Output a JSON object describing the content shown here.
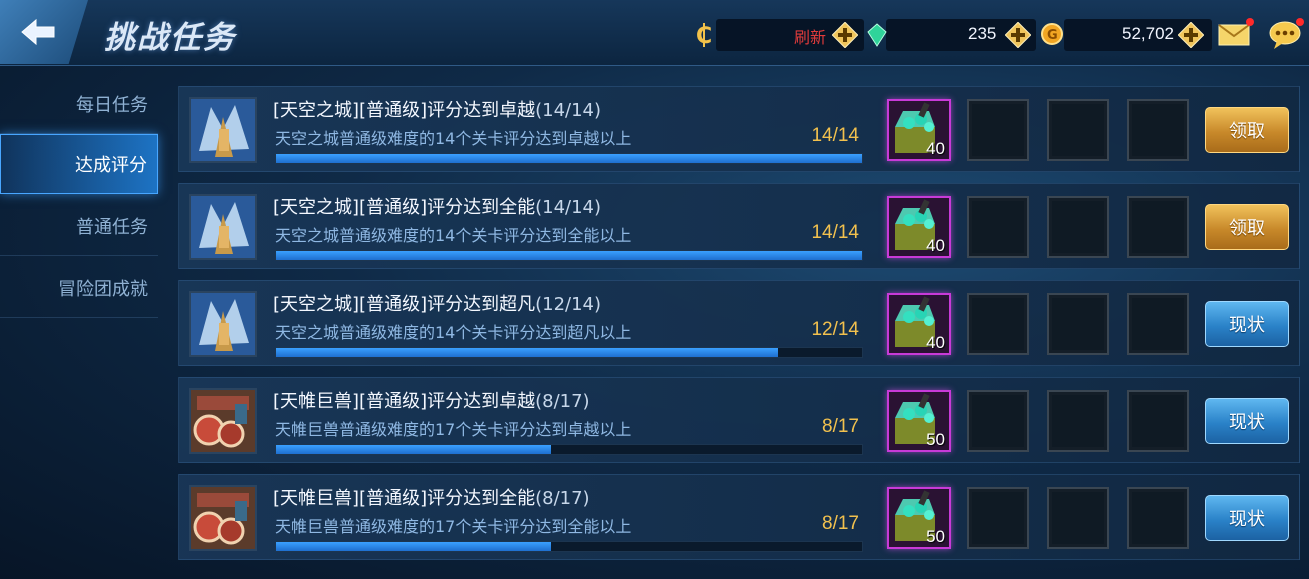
{
  "header": {
    "title": "挑战任务",
    "refresh_label": "刷新",
    "gems_value": "235",
    "gold_value": "52,702"
  },
  "sidebar": {
    "items": [
      {
        "label": "每日任务",
        "active": false
      },
      {
        "label": "达成评分",
        "active": true
      },
      {
        "label": "普通任务",
        "active": false
      },
      {
        "label": "冒险团成就",
        "active": false
      }
    ]
  },
  "tasks": [
    {
      "title": "[天空之城][普通级]评分达到卓越",
      "count": "(14/14)",
      "description": "天空之城普通级难度的14个关卡评分达到卓越以上",
      "progress_text": "14/14",
      "progress": 1.0,
      "reward_qty": "40",
      "button_label": "领取",
      "button_type": "claim",
      "icon": "sky-castle-icon"
    },
    {
      "title": "[天空之城][普通级]评分达到全能",
      "count": "(14/14)",
      "description": "天空之城普通级难度的14个关卡评分达到全能以上",
      "progress_text": "14/14",
      "progress": 1.0,
      "reward_qty": "40",
      "button_label": "领取",
      "button_type": "claim",
      "icon": "sky-castle-icon"
    },
    {
      "title": "[天空之城][普通级]评分达到超凡",
      "count": "(12/14)",
      "description": "天空之城普通级难度的14个关卡评分达到超凡以上",
      "progress_text": "12/14",
      "progress": 0.857,
      "reward_qty": "40",
      "button_label": "现状",
      "button_type": "status",
      "icon": "sky-castle-icon"
    },
    {
      "title": "[天帷巨兽][普通级]评分达到卓越",
      "count": "(8/17)",
      "description": "天帷巨兽普通级难度的17个关卡评分达到卓越以上",
      "progress_text": "8/17",
      "progress": 0.47,
      "reward_qty": "50",
      "button_label": "现状",
      "button_type": "status",
      "icon": "sky-beast-icon"
    },
    {
      "title": "[天帷巨兽][普通级]评分达到全能",
      "count": "(8/17)",
      "description": "天帷巨兽普通级难度的17个关卡评分达到全能以上",
      "progress_text": "8/17",
      "progress": 0.47,
      "reward_qty": "50",
      "button_label": "现状",
      "button_type": "status",
      "icon": "sky-beast-icon"
    }
  ],
  "colors": {
    "accent_blue": "#1d73c4",
    "claim_gold": "#c8892a",
    "refresh_red": "#e03b3b",
    "progress_text": "#f2c14e",
    "reward_border": "#c83ad8"
  }
}
